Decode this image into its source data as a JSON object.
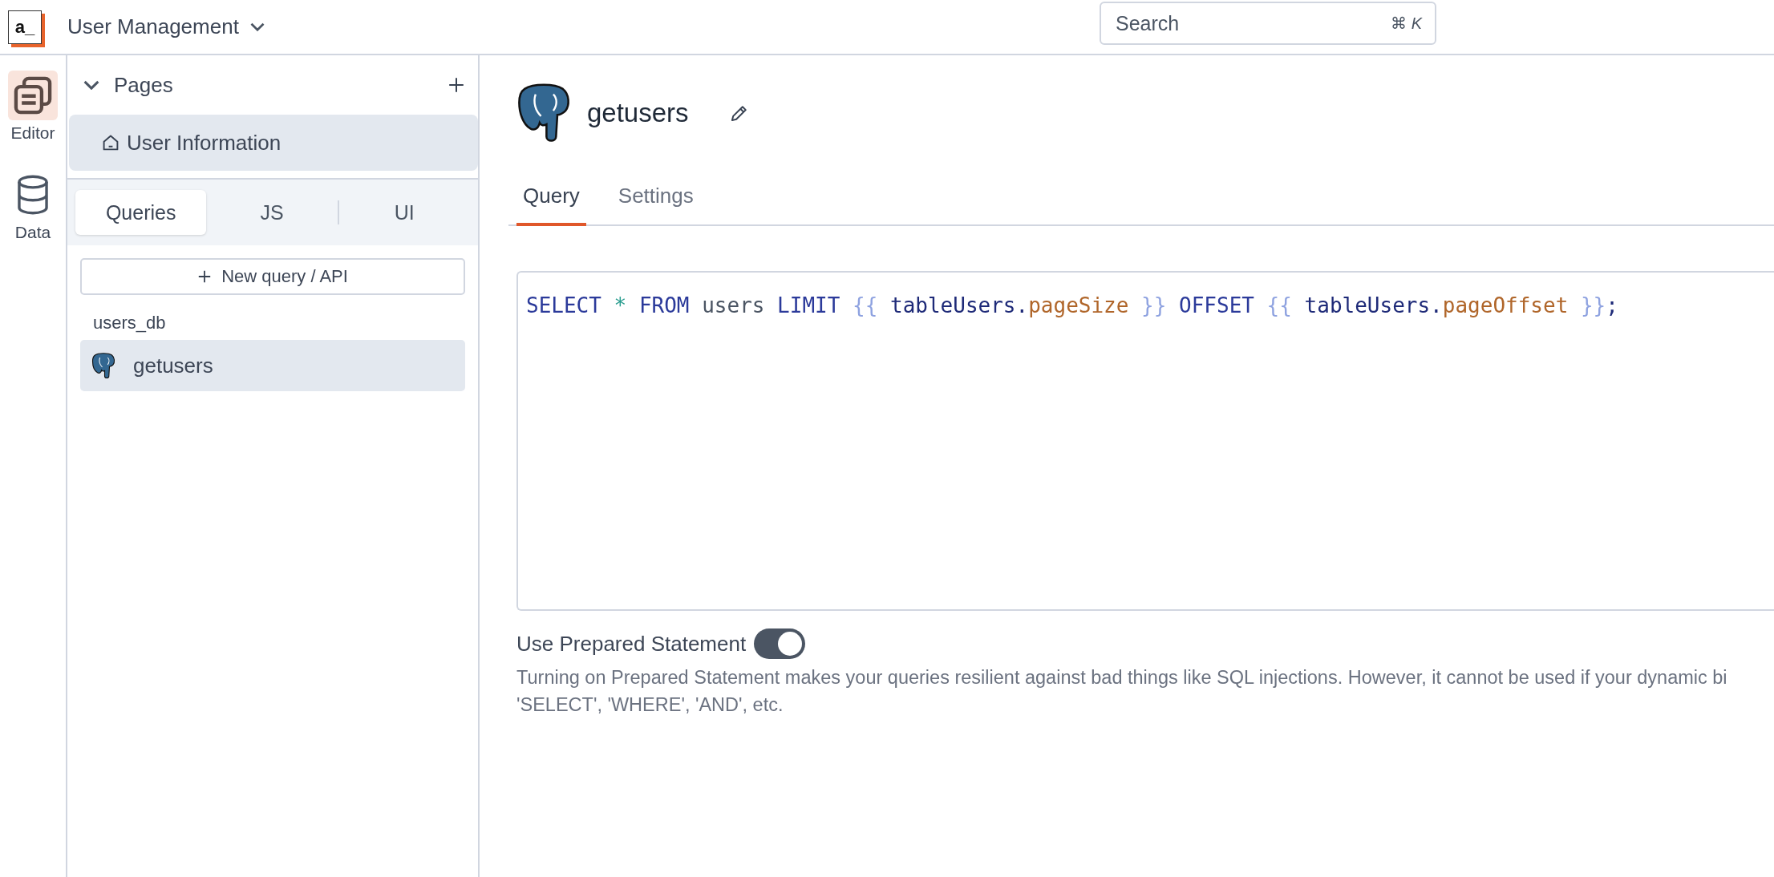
{
  "app": {
    "logo": "a_",
    "title": "User Management"
  },
  "search": {
    "placeholder": "Search",
    "shortcut_symbol": "⌘",
    "shortcut_key": "K"
  },
  "rail": [
    {
      "label": "Editor",
      "kind": "editor",
      "selected": true
    },
    {
      "label": "Data",
      "kind": "data",
      "selected": false
    }
  ],
  "pages": {
    "title": "Pages",
    "expanded": true,
    "items": [
      {
        "label": "User Information",
        "selected": true
      }
    ]
  },
  "sidebar_tabs": [
    {
      "label": "Queries",
      "selected": true
    },
    {
      "label": "JS",
      "selected": false
    },
    {
      "label": "UI",
      "selected": false
    }
  ],
  "new_query_button": "New query / API",
  "datasources": [
    {
      "name": "users_db",
      "queries": [
        {
          "name": "getusers",
          "selected": true
        }
      ]
    }
  ],
  "query": {
    "name": "getusers",
    "tabs": [
      {
        "label": "Query",
        "selected": true
      },
      {
        "label": "Settings",
        "selected": false
      }
    ],
    "code": [
      {
        "text": "SELECT ",
        "kind": "keyword"
      },
      {
        "text": "*",
        "kind": "operator"
      },
      {
        "text": " FROM",
        "kind": "keyword"
      },
      {
        "text": " users ",
        "kind": "plain"
      },
      {
        "text": "LIMIT ",
        "kind": "keyword"
      },
      {
        "text": "{{",
        "kind": "brace"
      },
      {
        "text": " tableUsers.",
        "kind": "variable"
      },
      {
        "text": "pageSize",
        "kind": "property"
      },
      {
        "text": " }}",
        "kind": "brace"
      },
      {
        "text": " OFFSET ",
        "kind": "keyword"
      },
      {
        "text": "{{",
        "kind": "brace"
      },
      {
        "text": " tableUsers.",
        "kind": "variable"
      },
      {
        "text": "pageOffset",
        "kind": "property"
      },
      {
        "text": " }}",
        "kind": "brace"
      },
      {
        "text": ";",
        "kind": "variable"
      }
    ],
    "prepared_statement": {
      "label": "Use Prepared Statement",
      "on": true,
      "help_lines": [
        "Turning on Prepared Statement makes your queries resilient against bad things like SQL injections. However, it cannot be used if your dynamic bi",
        "'SELECT', 'WHERE', 'AND', etc."
      ]
    }
  }
}
